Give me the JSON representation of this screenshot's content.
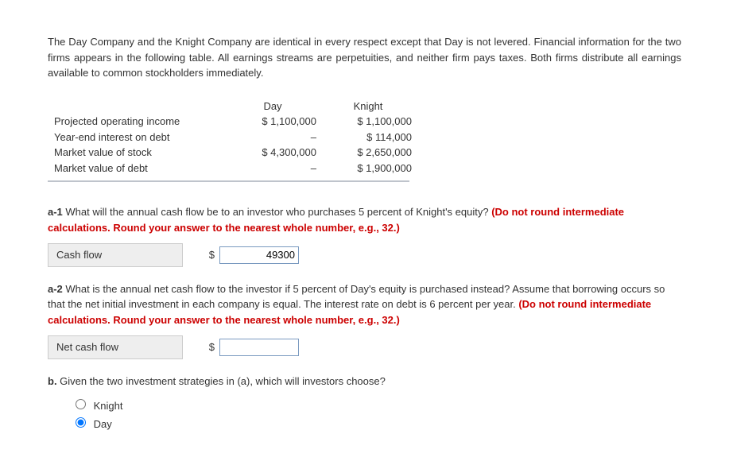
{
  "intro": "The Day Company and the Knight Company are identical in every respect except that Day is not levered. Financial information for the two firms appears in the following table. All earnings streams are perpetuities, and neither firm pays taxes. Both firms distribute all earnings available to common stockholders immediately.",
  "table": {
    "col1": "Day",
    "col2": "Knight",
    "rows": {
      "r0": {
        "label": "Projected operating income",
        "day": "$ 1,100,000",
        "knight": "$ 1,100,000"
      },
      "r1": {
        "label": "Year-end interest on debt",
        "day": "–",
        "knight": "$    114,000"
      },
      "r2": {
        "label": "Market value of stock",
        "day": "$ 4,300,000",
        "knight": "$ 2,650,000"
      },
      "r3": {
        "label": "Market value of debt",
        "day": "–",
        "knight": "$ 1,900,000"
      }
    }
  },
  "q_a1": {
    "num": "a-1",
    "text": " What will the annual cash flow be to an investor who purchases 5 percent of Knight's equity? ",
    "red": "(Do not round intermediate calculations. Round your answer to the nearest whole number, e.g., 32.)",
    "answer_label": "Cash flow",
    "currency": "$",
    "value": "49300"
  },
  "q_a2": {
    "num": "a-2",
    "text": " What is the annual net cash flow to the investor if 5 percent of Day's equity is purchased instead? Assume that borrowing occurs so that the net initial investment in each company is equal. The interest rate on debt is 6 percent per year. ",
    "red": "(Do not round intermediate calculations. Round your answer to the nearest whole number, e.g., 32.)",
    "answer_label": "Net cash flow",
    "currency": "$",
    "value": ""
  },
  "q_b": {
    "num": "b.",
    "text": " Given the two investment strategies in (a), which will investors choose?",
    "options": {
      "o0": "Knight",
      "o1": "Day"
    },
    "selected": "Day"
  }
}
